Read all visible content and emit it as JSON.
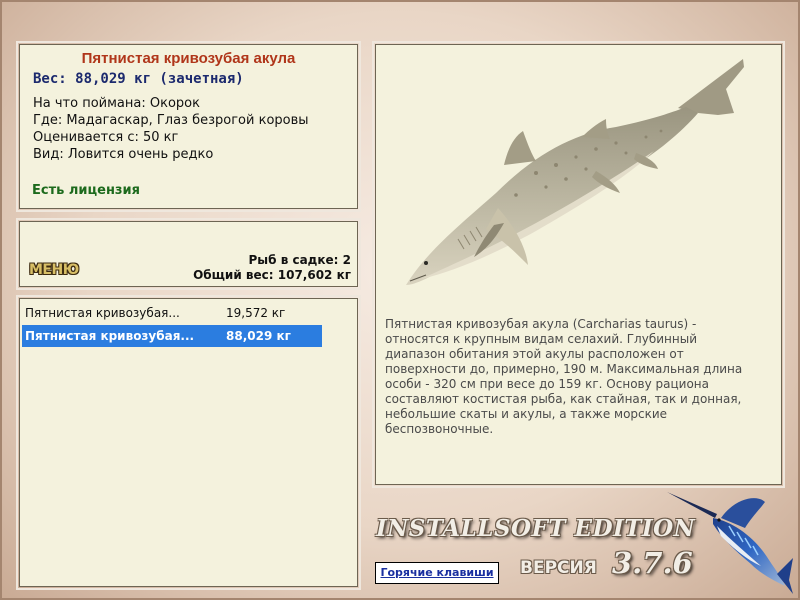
{
  "fish": {
    "title": "Пятнистая кривозубая акула",
    "weight": "Вес: 88,029 кг (зачетная)",
    "caught_with": "На что поймана: Окорок",
    "location": "Где: Мадагаскар, Глаз безрогой коровы",
    "valued_from": "Оценивается с: 50 кг",
    "species": "Вид: Ловится очень редко",
    "license": "Есть лицензия"
  },
  "cage": {
    "menu_label": "МЕНЮ",
    "fish_count": "Рыб в садке: 2",
    "total_weight": "Общий вес: 107,602 кг"
  },
  "catch_list": [
    {
      "name": "Пятнистая кривозубая...",
      "weight": "19,572 кг",
      "selected": false
    },
    {
      "name": "Пятнистая кривозубая...",
      "weight": "88,029 кг",
      "selected": true
    }
  ],
  "viewer": {
    "image_icon": "sand-tiger-shark-image",
    "description": "Пятнистая кривозубая акула (Carcharias taurus) - относятся к крупным видам селахий. Глубинный диапазон обитания этой акулы расположен от поверхности до, примерно, 190 м. Максимальная длина особи - 320 см при весе до 159 кг. Основу рациона составляют костистая рыба, как стайная, так и донная, небольшие скаты и акулы, а также морские беспозвоночные."
  },
  "footer": {
    "brand": "INSTALLSOFT EDITION",
    "hotkeys_label": "Горячие клавиши",
    "version_label": "ВЕРСИЯ",
    "version_number": "3.7.6",
    "logo_icon": "marlin-icon"
  },
  "colors": {
    "title": "#b0361a",
    "weight": "#1c2a6e",
    "license": "#1c6a1c",
    "selection": "#2b7de0",
    "panel": "#f4f2dd"
  }
}
